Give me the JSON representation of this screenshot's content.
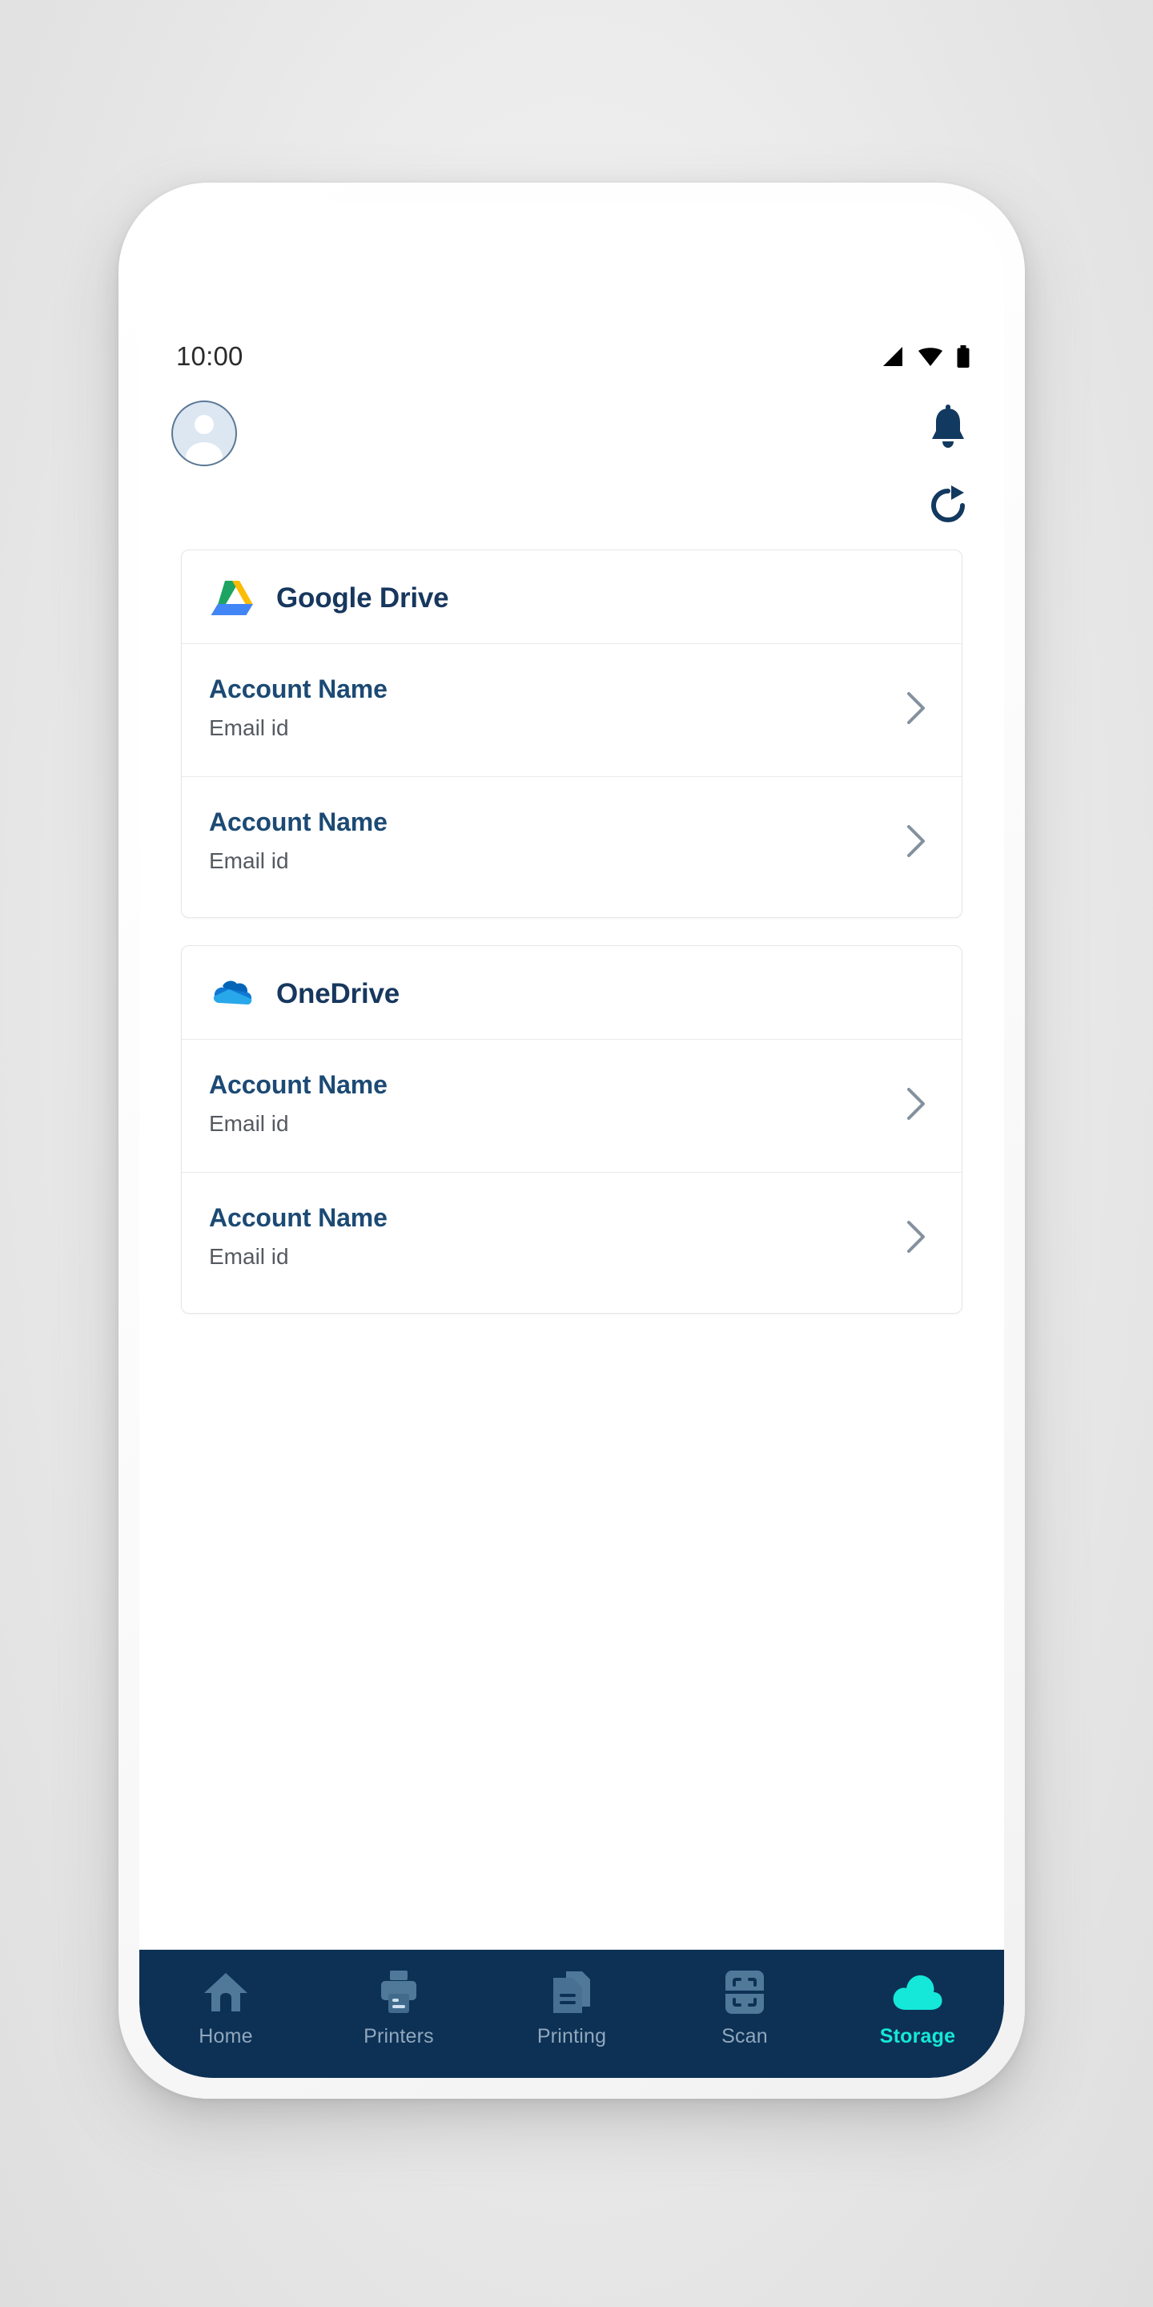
{
  "status_bar": {
    "time": "10:00",
    "icons": [
      "signal-icon",
      "wifi-icon",
      "battery-icon"
    ]
  },
  "header": {
    "avatar": "user-avatar",
    "notification_icon": "bell-icon",
    "refresh_icon": "refresh-icon"
  },
  "colors": {
    "brand_navy": "#0d3155",
    "title_navy": "#17375e",
    "account_name": "#1c4a74",
    "active_nav": "#15e8d8",
    "inactive_nav": "#90a7bd",
    "card_border": "#e6e6e6"
  },
  "storage_providers": [
    {
      "name": "Google Drive",
      "logo": "google-drive-logo",
      "accounts": [
        {
          "name": "Account Name",
          "email": "Email id",
          "chevron": "chevron-right-icon"
        },
        {
          "name": "Account Name",
          "email": "Email id",
          "chevron": "chevron-right-icon"
        }
      ]
    },
    {
      "name": "OneDrive",
      "logo": "onedrive-logo",
      "accounts": [
        {
          "name": "Account Name",
          "email": "Email id",
          "chevron": "chevron-right-icon"
        },
        {
          "name": "Account Name",
          "email": "Email id",
          "chevron": "chevron-right-icon"
        }
      ]
    }
  ],
  "bottom_nav": {
    "items": [
      {
        "label": "Home",
        "icon": "home-icon",
        "active": false
      },
      {
        "label": "Printers",
        "icon": "printer-icon",
        "active": false
      },
      {
        "label": "Printing",
        "icon": "documents-icon",
        "active": false
      },
      {
        "label": "Scan",
        "icon": "scan-icon",
        "active": false
      },
      {
        "label": "Storage",
        "icon": "cloud-icon",
        "active": true
      }
    ]
  }
}
